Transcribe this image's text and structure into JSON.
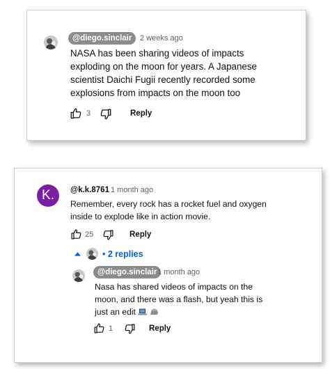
{
  "comments": [
    {
      "author": "@diego.sinclair",
      "time": "2 weeks ago",
      "text": "NASA has been sharing videos of impacts exploding on the moon for years. A Japanese scientist Daichi Fugii recently recorded some explosions from impacts on the moon too",
      "likes": "3",
      "reply_label": "Reply"
    },
    {
      "author_initial": "K.",
      "author": "@k.k.8761",
      "time": "1 month ago",
      "text": "Remember, every rock has a rocket fuel and oxygen inside to explode like in action movie.",
      "likes": "25",
      "reply_label": "Reply",
      "replies_toggle": "• 2 replies",
      "avatar_color": "#7b1fa2",
      "reply": {
        "author": "@diego.sinclair",
        "time": "1 month ago",
        "text": "Nasa has shared videos of impacts on the moon, and there was a flash, but yeah this is just an edit",
        "likes": "1",
        "reply_label": "Reply"
      }
    }
  ],
  "colors": {
    "link": "#065fd4",
    "chip_bg": "#8c8c8c",
    "muted_text": "#606060"
  },
  "icons": [
    "thumbs-up-icon",
    "thumbs-down-icon",
    "caret-up-icon",
    "laptop-emoji-icon",
    "rock-emoji-icon"
  ]
}
